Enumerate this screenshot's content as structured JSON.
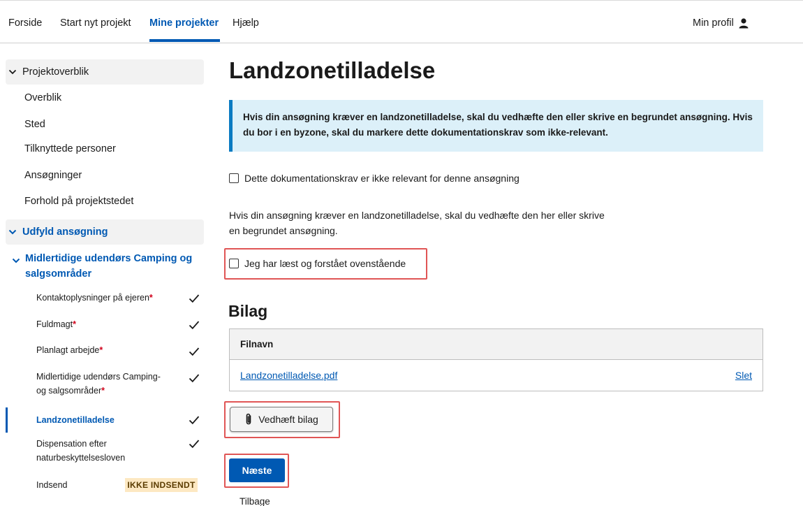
{
  "topnav": {
    "items": [
      "Forside",
      "Start nyt projekt",
      "Mine projekter",
      "Hjælp"
    ],
    "profile_label": "Min profil",
    "profile_icon": "person-icon"
  },
  "sidebar": {
    "overview_section": "Projektoverblik",
    "overview_items": [
      "Overblik",
      "Sted",
      "Tilknyttede personer",
      "Ansøgninger",
      "Forhold på projektstedet"
    ],
    "fill_section": "Udfyld ansøgning",
    "group_title": "Midlertidige udendørs Camping og salgsområder",
    "sub_items": [
      {
        "label": "Kontaktoplysninger på ejeren",
        "required": true
      },
      {
        "label": "Fuldmagt",
        "required": true
      },
      {
        "label": "Planlagt arbejde",
        "required": true
      },
      {
        "label": "Midlertidige udendørs Camping- og salgsområder",
        "required": true
      },
      {
        "label": "Landzonetilladelse",
        "required": false
      },
      {
        "label": "Dispensation efter naturbeskyttelsesloven",
        "required": false
      },
      {
        "label": "Indsend",
        "required": false
      }
    ],
    "required_mark": "*",
    "status_badge": "IKKE INDSENDT"
  },
  "main": {
    "title": "Landzonetilladelse",
    "info_text": "Hvis din ansøgning kræver en landzonetilladelse, skal du vedhæfte den eller skrive en begrundet ansøgning. Hvis du bor i en byzone, skal du markere dette dokumentationskrav som ikke-relevant.",
    "not_relevant_label": "Dette dokumentationskrav er ikke relevant for denne ansøgning",
    "para_line1": "Hvis din ansøgning kræver en landzonetilladelse, skal du vedhæfte den her eller skrive",
    "para_line2": "en begrundet ansøgning.",
    "understood_label": "Jeg har læst og forstået ovenstående",
    "attachments_title": "Bilag",
    "table_header": "Filnavn",
    "file_name": "Landzonetilladelse.pdf",
    "delete_label": "Slet",
    "attach_button": "Vedhæft bilag",
    "next_button": "Næste",
    "back_label": "Tilbage"
  },
  "colors": {
    "primary": "#0059b3",
    "info_bg": "#dcf0f9",
    "info_border": "#0a7bc2",
    "highlight": "#e05555",
    "badge_bg": "#fde8c2"
  }
}
